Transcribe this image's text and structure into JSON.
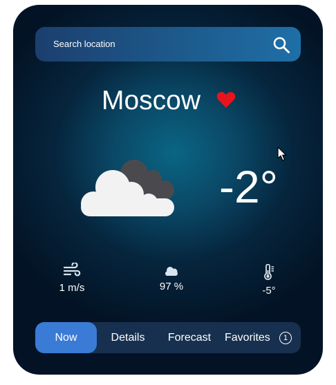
{
  "search": {
    "placeholder": "Search location",
    "icon": "search-icon"
  },
  "location": {
    "city": "Moscow",
    "favorite_icon": "heart-icon",
    "favorite_color": "#e8141d"
  },
  "current": {
    "condition_icon": "cloudy-icon",
    "temperature": "-2°"
  },
  "stats": {
    "wind": {
      "icon": "wind-icon",
      "value": "1 m/s"
    },
    "humidity": {
      "icon": "cloud-icon",
      "value": "97 %"
    },
    "feels_like": {
      "icon": "thermometer-icon",
      "value": "-5°"
    }
  },
  "tabs": [
    {
      "label": "Now",
      "active": true
    },
    {
      "label": "Details",
      "active": false
    },
    {
      "label": "Forecast",
      "active": false
    },
    {
      "label": "Favorites",
      "active": false,
      "badge": "1"
    }
  ],
  "colors": {
    "accent": "#3a7bd5",
    "tab_bar": "#18304f",
    "search_bar": "#1d5a8c"
  }
}
